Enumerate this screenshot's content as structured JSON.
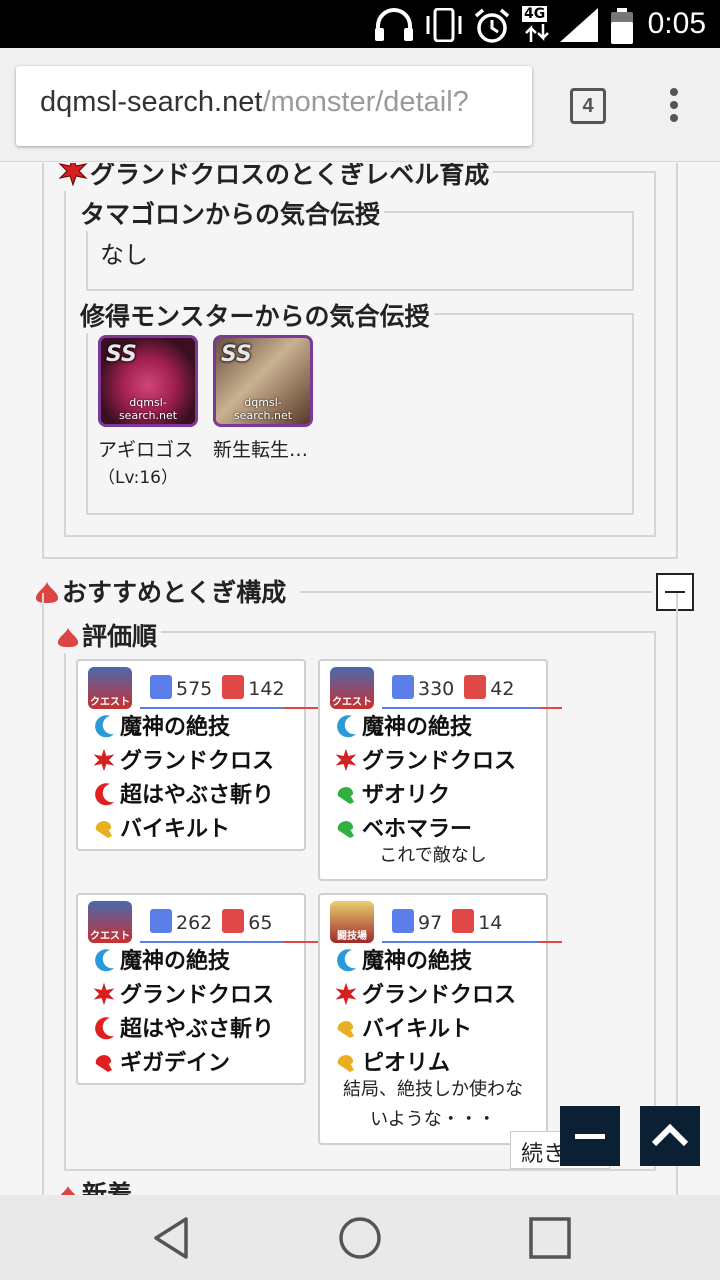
{
  "status_bar": {
    "time": "0:05",
    "network": "4G"
  },
  "browser": {
    "url_host": "dqmsl-search.net",
    "url_path": "/monster/detail?",
    "tab_count": "4"
  },
  "growth_section": {
    "title": "グランドクロスのとくぎレベル育成",
    "tamagon": {
      "title": "タマゴロンからの気合伝授",
      "value": "なし"
    },
    "monsters": {
      "title": "修得モンスターからの気合伝授",
      "items": [
        {
          "name": "アギロゴス",
          "level": "（Lv:16）",
          "rank": "SS",
          "watermark": "dqmsl-search.net"
        },
        {
          "name": "新生転生…",
          "rank": "SS",
          "watermark": "dqmsl-search.net"
        }
      ]
    }
  },
  "recommend_section": {
    "title": "おすすめとくぎ構成",
    "subtitle": "評価順",
    "next_heading": "新着",
    "more_label": "続きを見る",
    "cards": [
      {
        "badge": "クエスト",
        "likes": "575",
        "dislikes": "142",
        "skills": [
          "魔神の絶技",
          "グランドクロス",
          "超はやぶさ斬り",
          "バイキルト"
        ],
        "comment": ""
      },
      {
        "badge": "クエスト",
        "likes": "330",
        "dislikes": "42",
        "skills": [
          "魔神の絶技",
          "グランドクロス",
          "ザオリク",
          "ベホマラー"
        ],
        "comment": "これで敵なし"
      },
      {
        "badge": "クエスト",
        "likes": "262",
        "dislikes": "65",
        "skills": [
          "魔神の絶技",
          "グランドクロス",
          "超はやぶさ斬り",
          "ギガデイン"
        ],
        "comment": ""
      },
      {
        "badge": "闘技場",
        "likes": "97",
        "dislikes": "14",
        "skills": [
          "魔神の絶技",
          "グランドクロス",
          "バイキルト",
          "ピオリム"
        ],
        "comment_lines": [
          "結局、絶技しか使わな",
          "いような・・・"
        ]
      }
    ]
  },
  "colors": {
    "accent_red": "#d42020",
    "like_blue": "#5b7ee8",
    "dislike_red": "#e04848",
    "fab_dark": "#0b2133"
  }
}
